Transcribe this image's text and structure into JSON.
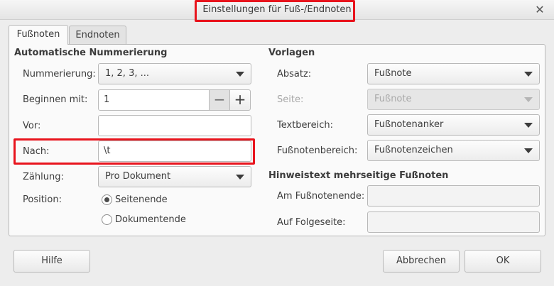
{
  "window": {
    "title": "Einstellungen für Fuß-/Endnoten",
    "close_symbol": "✕"
  },
  "tabs": [
    {
      "label": "Fußnoten",
      "active": true
    },
    {
      "label": "Endnoten",
      "active": false
    }
  ],
  "numbering": {
    "heading": "Automatische Nummerierung",
    "numbering_label": "Nummerierung:",
    "numbering_value": "1, 2, 3, ...",
    "start_label": "Beginnen mit:",
    "start_value": "1",
    "before_label": "Vor:",
    "before_value": "",
    "after_label": "Nach:",
    "after_value": "\\t",
    "counting_label": "Zählung:",
    "counting_value": "Pro Dokument",
    "position_label": "Position:",
    "position_options": [
      {
        "label": "Seitenende",
        "checked": true
      },
      {
        "label": "Dokumentende",
        "checked": false
      }
    ]
  },
  "templates": {
    "heading": "Vorlagen",
    "paragraph_label": "Absatz:",
    "paragraph_value": "Fußnote",
    "page_label": "Seite:",
    "page_value": "Fußnote",
    "text_area_label": "Textbereich:",
    "text_area_value": "Fußnotenanker",
    "footnote_area_label": "Fußnotenbereich:",
    "footnote_area_value": "Fußnotenzeichen"
  },
  "continuation": {
    "heading": "Hinweistext mehrseitige Fußnoten",
    "end_label": "Am Fußnotenende:",
    "end_value": "",
    "next_page_label": "Auf Folgeseite:",
    "next_page_value": ""
  },
  "buttons": {
    "help": "Hilfe",
    "cancel": "Abbrechen",
    "ok": "OK"
  },
  "colors": {
    "highlight": "#e8141d"
  }
}
